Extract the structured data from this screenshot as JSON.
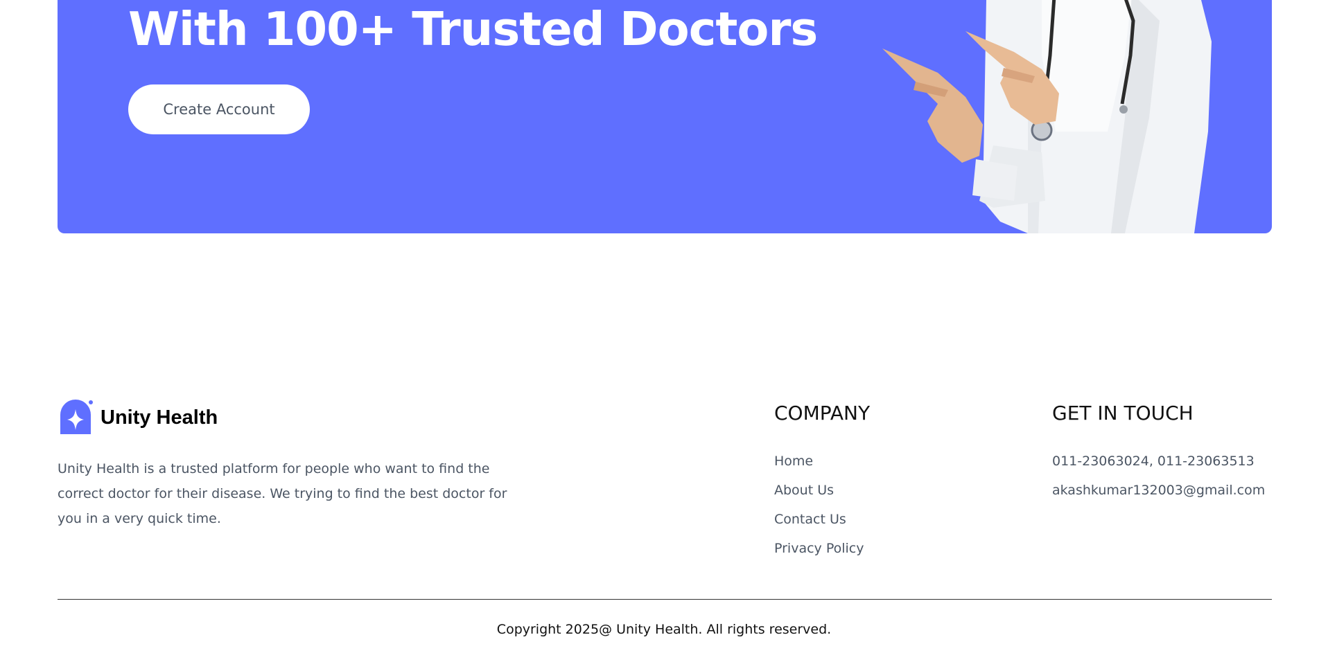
{
  "banner": {
    "title": "With 100+ Trusted Doctors",
    "cta_label": "Create Account",
    "background_color": "#5f6fff"
  },
  "footer": {
    "brand": {
      "name": "Unity Health",
      "icon": "brand-sparkle-logo-icon",
      "description": "Unity Health is a trusted platform for people who want to find the correct doctor for their disease. We trying to find the best doctor for you in a very quick time."
    },
    "company": {
      "heading": "COMPANY",
      "links": [
        "Home",
        "About Us",
        "Contact Us",
        "Privacy Policy"
      ]
    },
    "contact": {
      "heading": "GET IN TOUCH",
      "phone": "011-23063024, 011-23063513",
      "email": "akashkumar132003@gmail.com"
    },
    "copyright": "Copyright 2025@ Unity Health. All rights reserved."
  }
}
